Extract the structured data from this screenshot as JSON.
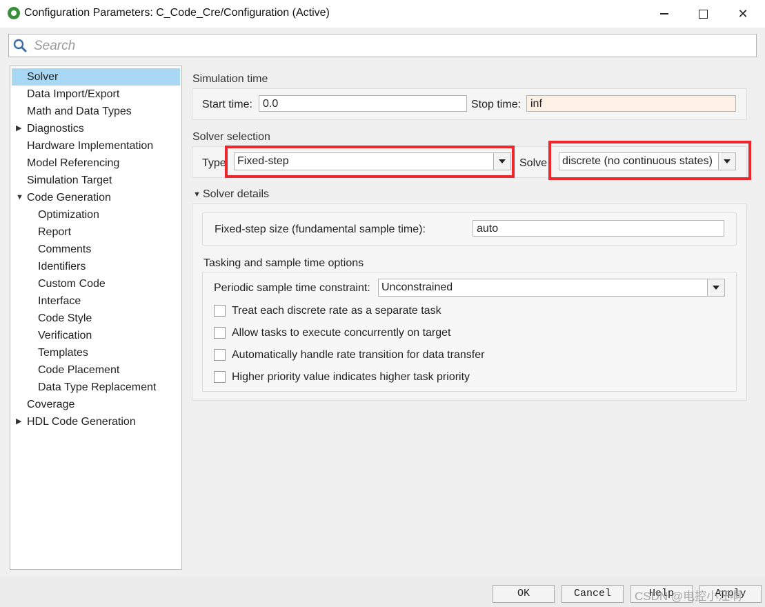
{
  "window": {
    "title": "Configuration Parameters: C_Code_Cre/Configuration (Active)",
    "app_icon": "simulink-gear-icon"
  },
  "search": {
    "placeholder": "Search",
    "value": ""
  },
  "sidebar": {
    "items": [
      {
        "label": "Solver",
        "selected": true,
        "expander": null
      },
      {
        "label": "Data Import/Export"
      },
      {
        "label": "Math and Data Types"
      },
      {
        "label": "Diagnostics",
        "expander": "collapsed"
      },
      {
        "label": "Hardware Implementation"
      },
      {
        "label": "Model Referencing"
      },
      {
        "label": "Simulation Target"
      },
      {
        "label": "Code Generation",
        "expander": "expanded"
      },
      {
        "label": "Optimization",
        "indent": 1
      },
      {
        "label": "Report",
        "indent": 1
      },
      {
        "label": "Comments",
        "indent": 1
      },
      {
        "label": "Identifiers",
        "indent": 1
      },
      {
        "label": "Custom Code",
        "indent": 1
      },
      {
        "label": "Interface",
        "indent": 1
      },
      {
        "label": "Code Style",
        "indent": 1
      },
      {
        "label": "Verification",
        "indent": 1
      },
      {
        "label": "Templates",
        "indent": 1
      },
      {
        "label": "Code Placement",
        "indent": 1
      },
      {
        "label": "Data Type Replacement",
        "indent": 1
      },
      {
        "label": "Coverage"
      },
      {
        "label": "HDL Code Generation",
        "expander": "collapsed"
      }
    ]
  },
  "simulation_time": {
    "section_label": "Simulation time",
    "start_label": "Start time:",
    "start_value": "0.0",
    "stop_label": "Stop time:",
    "stop_value": "inf"
  },
  "solver_selection": {
    "section_label": "Solver selection",
    "type_label": "Type",
    "type_value": "Fixed-step",
    "solver_label": "Solve",
    "solver_value": "discrete (no continuous states)"
  },
  "solver_details": {
    "section_label": "Solver details",
    "fixed_step_label": "Fixed-step size (fundamental sample time):",
    "fixed_step_value": "auto",
    "tasking_label": "Tasking and sample time options",
    "periodic_label": "Periodic sample time constraint:",
    "periodic_value": "Unconstrained",
    "checkboxes": [
      {
        "label": "Treat each discrete rate as a separate task",
        "checked": false
      },
      {
        "label": "Allow tasks to execute concurrently on target",
        "checked": false
      },
      {
        "label": "Automatically handle rate transition for data transfer",
        "checked": false
      },
      {
        "label": "Higher priority value indicates higher task priority",
        "checked": false
      }
    ]
  },
  "footer": {
    "ok_label": "OK",
    "cancel_label": "Cancel",
    "help_label": "Help",
    "apply_label": "Apply"
  },
  "watermark": "CSDN @电控小汪啊",
  "colors": {
    "highlight": "#f0262d",
    "selected": "#a9d8f5",
    "stop_field_bg": "#fdf1e5"
  }
}
